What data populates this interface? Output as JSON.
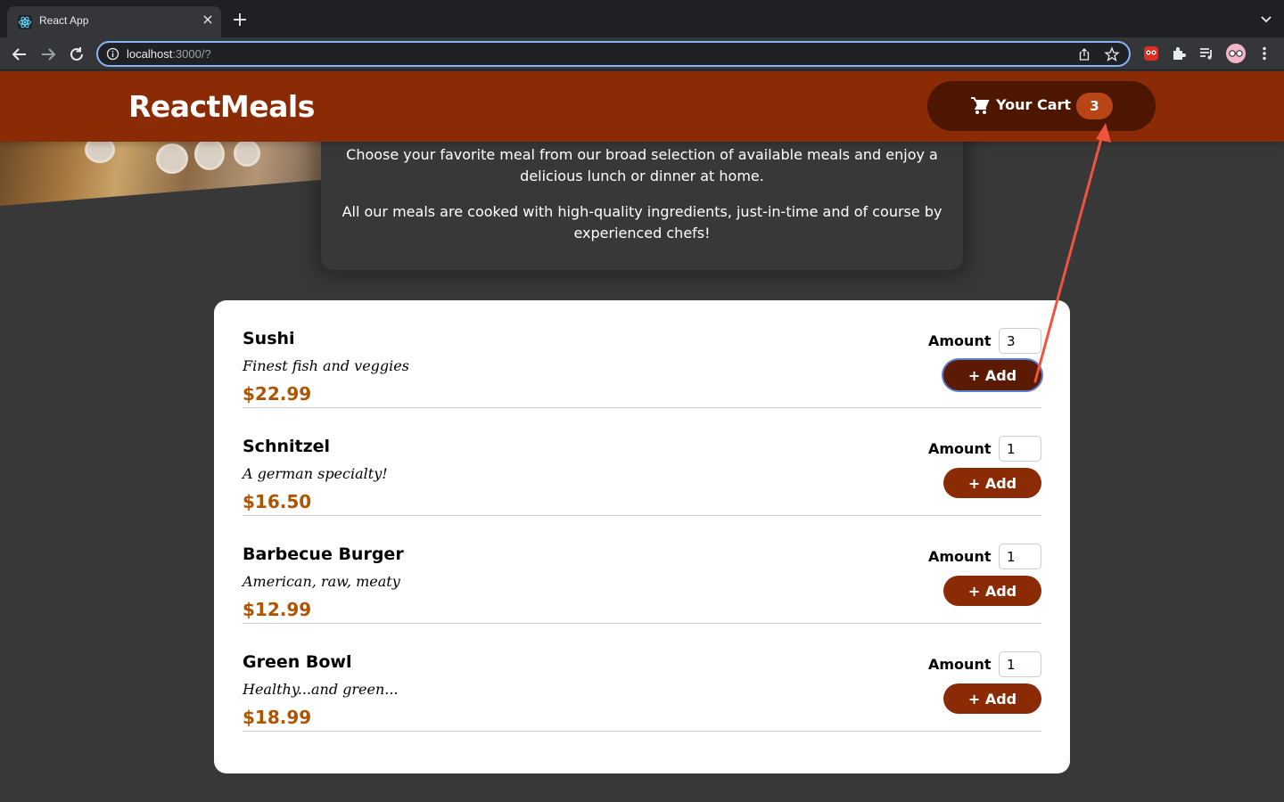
{
  "browser": {
    "tab_title": "React App",
    "url_host": "localhost",
    "url_rest": ":3000/?"
  },
  "header": {
    "brand": "ReactMeals",
    "cart_label": "Your Cart",
    "cart_count": "3"
  },
  "summary": {
    "paragraph1": "Choose your favorite meal from our broad selection of available meals and enjoy a delicious lunch or dinner at home.",
    "paragraph2": "All our meals are cooked with high-quality ingredients, just-in-time and of course by experienced chefs!"
  },
  "meals": [
    {
      "name": "Sushi",
      "description": "Finest fish and veggies",
      "price": "$22.99",
      "amount_label": "Amount",
      "amount": "3",
      "add_label": "+ Add"
    },
    {
      "name": "Schnitzel",
      "description": "A german specialty!",
      "price": "$16.50",
      "amount_label": "Amount",
      "amount": "1",
      "add_label": "+ Add"
    },
    {
      "name": "Barbecue Burger",
      "description": "American, raw, meaty",
      "price": "$12.99",
      "amount_label": "Amount",
      "amount": "1",
      "add_label": "+ Add"
    },
    {
      "name": "Green Bowl",
      "description": "Healthy...and green...",
      "price": "$18.99",
      "amount_label": "Amount",
      "amount": "1",
      "add_label": "+ Add"
    }
  ],
  "colors": {
    "header": "#8a2b06",
    "cart_button": "#4d1601",
    "badge": "#b94517",
    "price": "#ad5502",
    "annotation_arrow": "#f0533e"
  },
  "icons": [
    "react-favicon",
    "close-icon",
    "plus-icon",
    "chevron-down-icon",
    "back-arrow-icon",
    "forward-arrow-icon",
    "reload-icon",
    "info-icon",
    "share-icon",
    "star-icon",
    "extensions-icon",
    "media-icon",
    "profile-avatar",
    "menu-dots-icon",
    "cart-icon"
  ]
}
